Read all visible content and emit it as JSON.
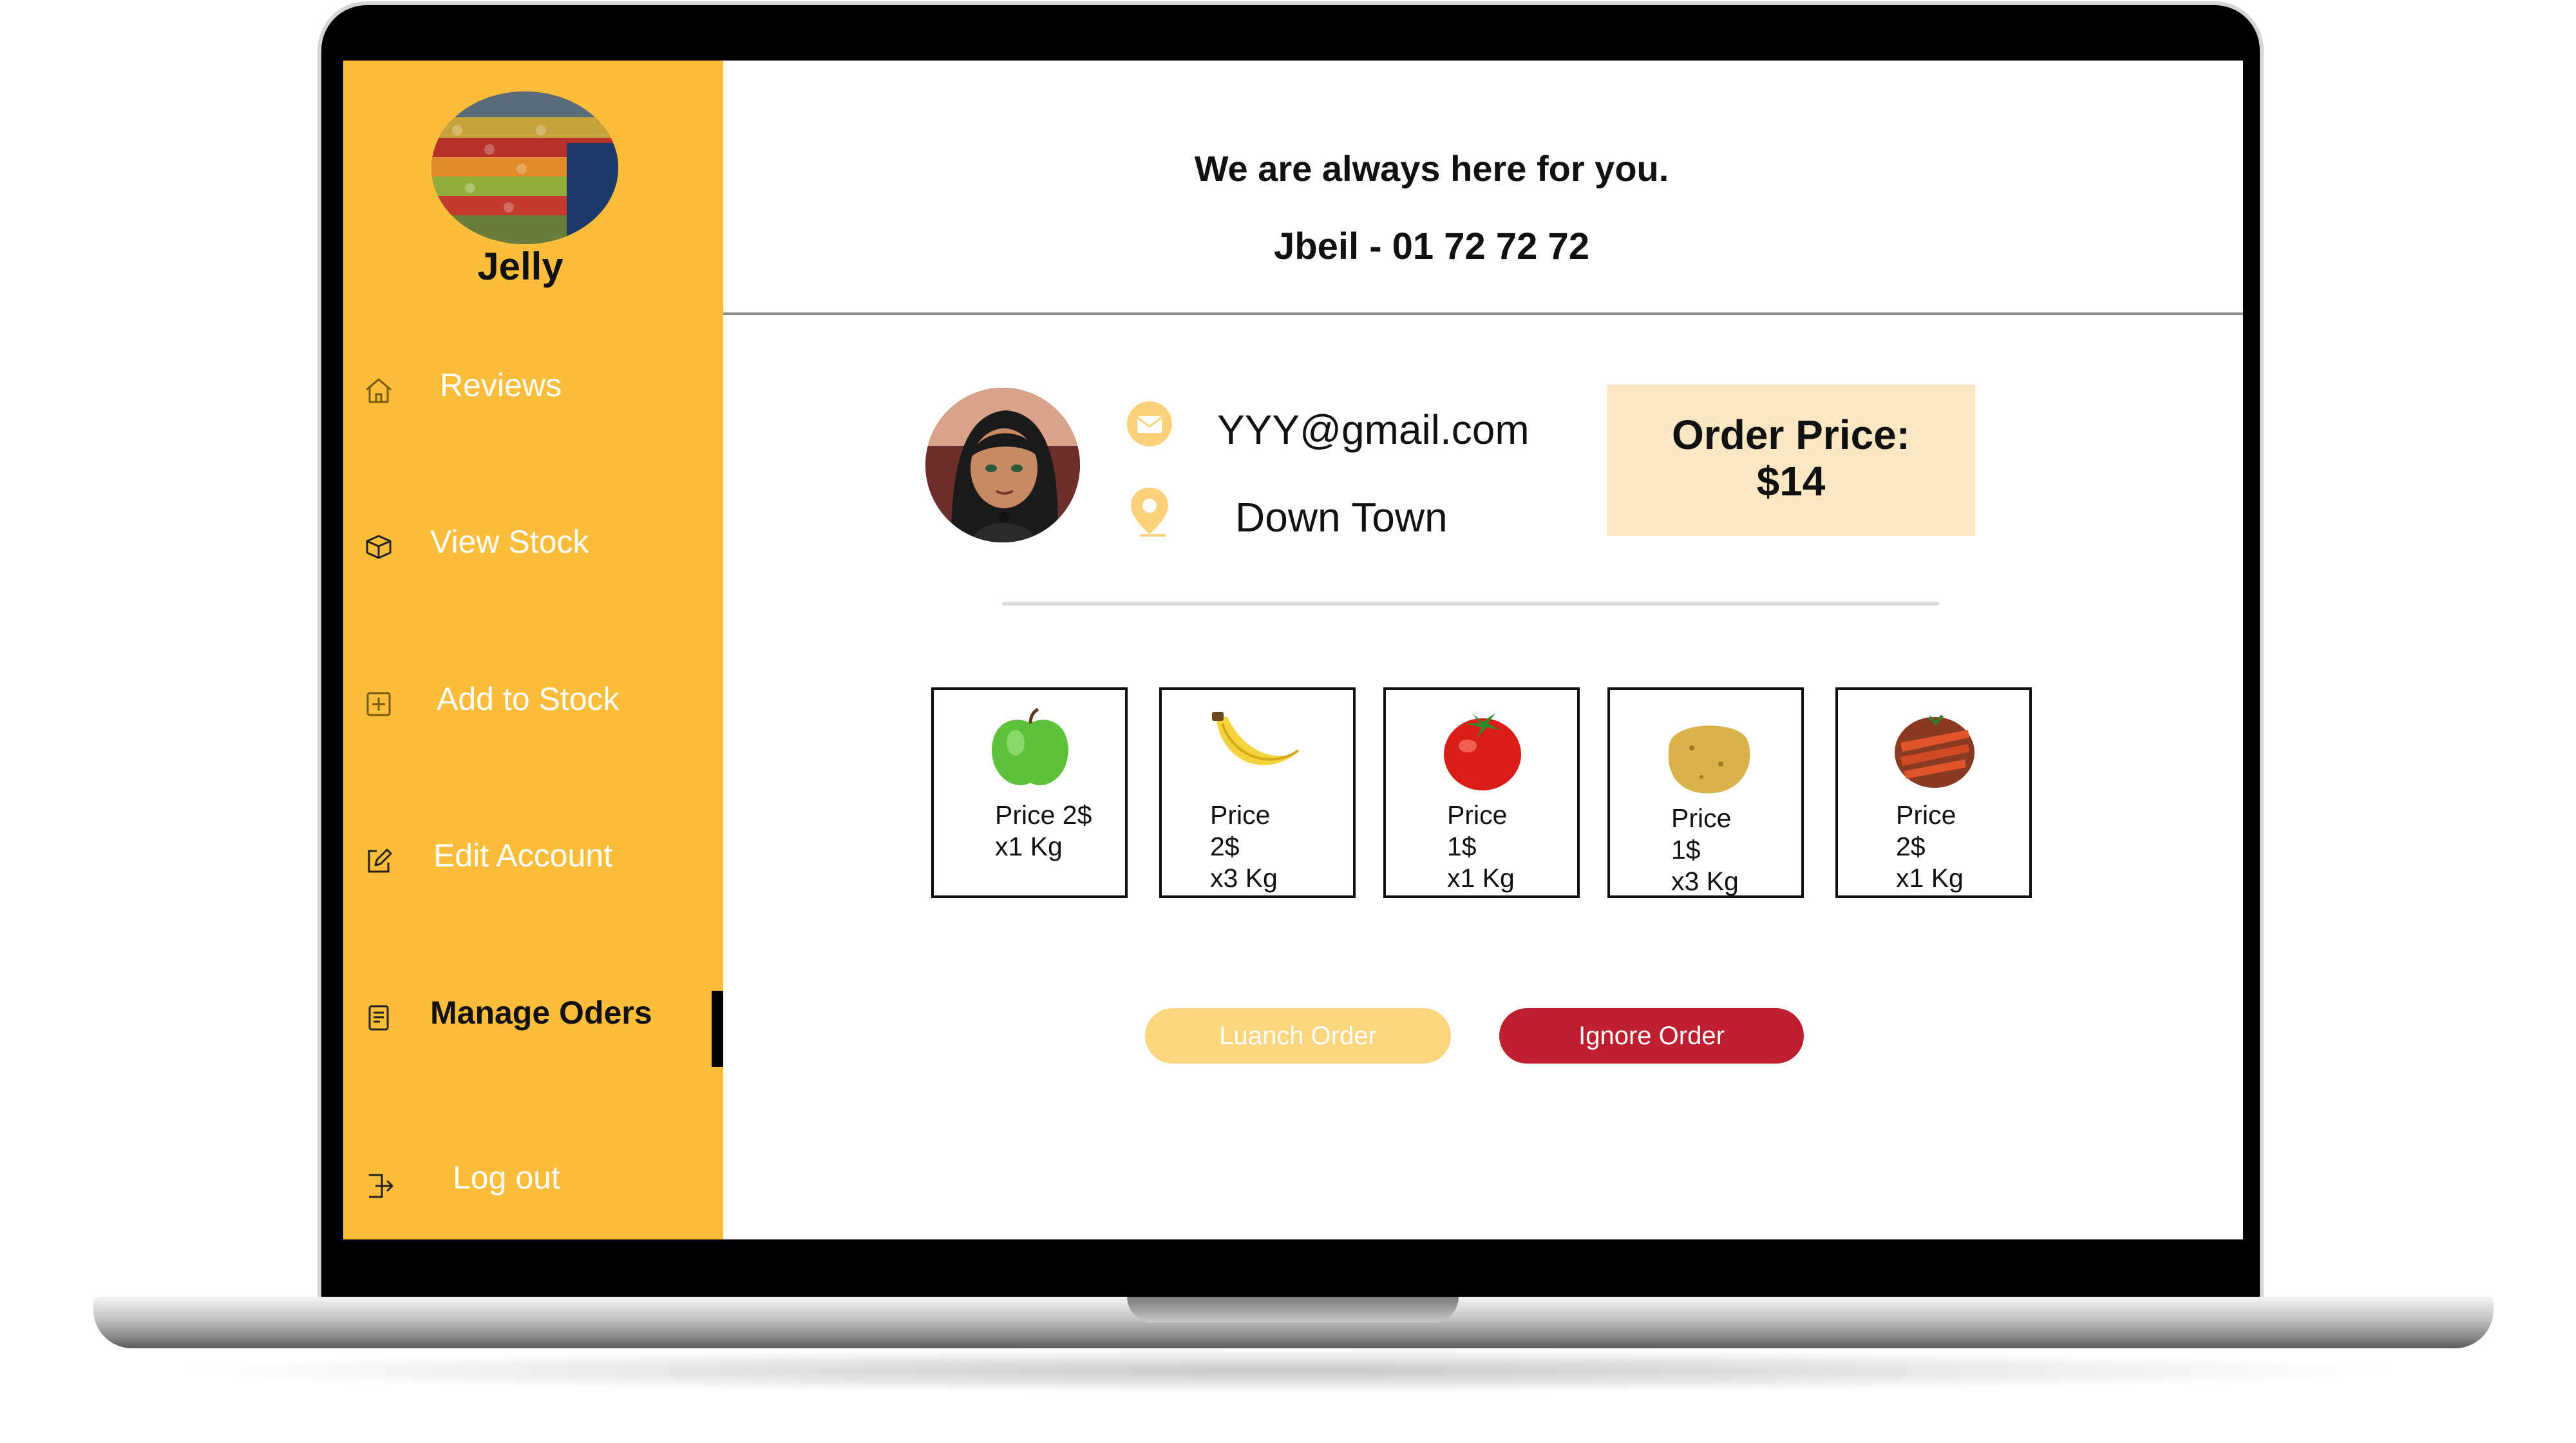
{
  "sidebar": {
    "store_name": "Jelly",
    "items": [
      {
        "label": "Reviews",
        "icon": "home-icon",
        "active": false
      },
      {
        "label": "View Stock",
        "icon": "box-icon",
        "active": false
      },
      {
        "label": "Add to Stock",
        "icon": "plus-square-icon",
        "active": false
      },
      {
        "label": "Edit Account",
        "icon": "edit-icon",
        "active": false
      },
      {
        "label": "Manage Oders",
        "icon": "document-icon",
        "active": true
      },
      {
        "label": "Log out",
        "icon": "logout-icon",
        "active": false
      }
    ]
  },
  "header": {
    "tagline": "We are always here for you.",
    "contact": "Jbeil - 01 72 72 72"
  },
  "customer": {
    "email": "YYY@gmail.com",
    "location": "Down Town"
  },
  "order": {
    "price_label": "Order Price:",
    "price_value": "$14"
  },
  "products": [
    {
      "name": "apple",
      "lines": [
        "Price 2$",
        "x1 Kg"
      ]
    },
    {
      "name": "banana",
      "lines": [
        "Price",
        "2$",
        "x3 Kg"
      ]
    },
    {
      "name": "tomato",
      "lines": [
        "Price",
        "1$",
        "x1 Kg"
      ]
    },
    {
      "name": "potato",
      "lines": [
        "Price",
        "1$",
        "x3 Kg"
      ]
    },
    {
      "name": "carrot",
      "lines": [
        "Price",
        "2$",
        "x1 Kg"
      ]
    }
  ],
  "actions": {
    "launch_label": "Luanch Order",
    "ignore_label": "Ignore Order"
  },
  "colors": {
    "sidebar_bg": "#fbbd3a",
    "price_box_bg": "#fbe8c2",
    "launch_button": "#fdd57c",
    "ignore_button": "#bf1e2e"
  }
}
